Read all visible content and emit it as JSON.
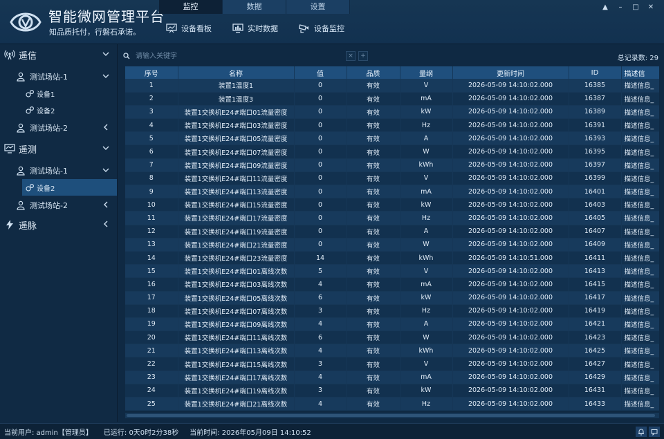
{
  "app": {
    "title": "智能微网管理平台",
    "slogan": "知品质托付，行磐石承诺。"
  },
  "top_tabs": [
    {
      "label": "监控",
      "active": true
    },
    {
      "label": "数据",
      "active": false
    },
    {
      "label": "设置",
      "active": false
    }
  ],
  "toolbar": {
    "device_board": "设备看板",
    "realtime_data": "实时数据",
    "device_monitor": "设备监控"
  },
  "window_controls": [
    "▲",
    "–",
    "□",
    "✕"
  ],
  "sidebar": {
    "telecomm": {
      "label": "遥信",
      "station1": "测试场站-1",
      "device1": "设备1",
      "device2": "设备2",
      "station2": "测试场站-2"
    },
    "telemetry": {
      "label": "遥测",
      "station1": "测试场站-1",
      "device2": "设备2",
      "station2": "测试场站-2"
    },
    "telepulse": {
      "label": "遥脉"
    }
  },
  "search": {
    "placeholder": "请输入关键字",
    "record_count": "总记录数: 29"
  },
  "table": {
    "headers": [
      "序号",
      "名称",
      "值",
      "品质",
      "量纲",
      "更新时间",
      "ID",
      "描述信"
    ],
    "rows": [
      [
        "1",
        "装置1温度1",
        "0",
        "有效",
        "V",
        "2026-05-09 14:10:02.000",
        "16385",
        "描述信息_"
      ],
      [
        "2",
        "装置1温度3",
        "0",
        "有效",
        "mA",
        "2026-05-09 14:10:02.000",
        "16387",
        "描述信息_"
      ],
      [
        "3",
        "装置1交换机E24#端口01流量密度",
        "0",
        "有效",
        "kW",
        "2026-05-09 14:10:02.000",
        "16389",
        "描述信息_"
      ],
      [
        "4",
        "装置1交换机E24#端口03流量密度",
        "0",
        "有效",
        "Hz",
        "2026-05-09 14:10:02.000",
        "16391",
        "描述信息_"
      ],
      [
        "5",
        "装置1交换机E24#端口05流量密度",
        "0",
        "有效",
        "A",
        "2026-05-09 14:10:02.000",
        "16393",
        "描述信息_"
      ],
      [
        "6",
        "装置1交换机E24#端口07流量密度",
        "0",
        "有效",
        "W",
        "2026-05-09 14:10:02.000",
        "16395",
        "描述信息_"
      ],
      [
        "7",
        "装置1交换机E24#端口09流量密度",
        "0",
        "有效",
        "kWh",
        "2026-05-09 14:10:02.000",
        "16397",
        "描述信息_"
      ],
      [
        "8",
        "装置1交换机E24#端口11流量密度",
        "0",
        "有效",
        "V",
        "2026-05-09 14:10:02.000",
        "16399",
        "描述信息_"
      ],
      [
        "9",
        "装置1交换机E24#端口13流量密度",
        "0",
        "有效",
        "mA",
        "2026-05-09 14:10:02.000",
        "16401",
        "描述信息_"
      ],
      [
        "10",
        "装置1交换机E24#端口15流量密度",
        "0",
        "有效",
        "kW",
        "2026-05-09 14:10:02.000",
        "16403",
        "描述信息_"
      ],
      [
        "11",
        "装置1交换机E24#端口17流量密度",
        "0",
        "有效",
        "Hz",
        "2026-05-09 14:10:02.000",
        "16405",
        "描述信息_"
      ],
      [
        "12",
        "装置1交换机E24#端口19流量密度",
        "0",
        "有效",
        "A",
        "2026-05-09 14:10:02.000",
        "16407",
        "描述信息_"
      ],
      [
        "13",
        "装置1交换机E24#端口21流量密度",
        "0",
        "有效",
        "W",
        "2026-05-09 14:10:02.000",
        "16409",
        "描述信息_"
      ],
      [
        "14",
        "装置1交换机E24#端口23流量密度",
        "14",
        "有效",
        "kWh",
        "2026-05-09 14:10:51.000",
        "16411",
        "描述信息_"
      ],
      [
        "15",
        "装置1交换机E24#端口01离线次数",
        "5",
        "有效",
        "V",
        "2026-05-09 14:10:02.000",
        "16413",
        "描述信息_"
      ],
      [
        "16",
        "装置1交换机E24#端口03离线次数",
        "4",
        "有效",
        "mA",
        "2026-05-09 14:10:02.000",
        "16415",
        "描述信息_"
      ],
      [
        "17",
        "装置1交换机E24#端口05离线次数",
        "6",
        "有效",
        "kW",
        "2026-05-09 14:10:02.000",
        "16417",
        "描述信息_"
      ],
      [
        "18",
        "装置1交换机E24#端口07离线次数",
        "3",
        "有效",
        "Hz",
        "2026-05-09 14:10:02.000",
        "16419",
        "描述信息_"
      ],
      [
        "19",
        "装置1交换机E24#端口09离线次数",
        "4",
        "有效",
        "A",
        "2026-05-09 14:10:02.000",
        "16421",
        "描述信息_"
      ],
      [
        "20",
        "装置1交换机E24#端口11离线次数",
        "6",
        "有效",
        "W",
        "2026-05-09 14:10:02.000",
        "16423",
        "描述信息_"
      ],
      [
        "21",
        "装置1交换机E24#端口13离线次数",
        "4",
        "有效",
        "kWh",
        "2026-05-09 14:10:02.000",
        "16425",
        "描述信息_"
      ],
      [
        "22",
        "装置1交换机E24#端口15离线次数",
        "3",
        "有效",
        "V",
        "2026-05-09 14:10:02.000",
        "16427",
        "描述信息_"
      ],
      [
        "23",
        "装置1交换机E24#端口17离线次数",
        "4",
        "有效",
        "mA",
        "2026-05-09 14:10:02.000",
        "16429",
        "描述信息_"
      ],
      [
        "24",
        "装置1交换机E24#端口19离线次数",
        "3",
        "有效",
        "kW",
        "2026-05-09 14:10:02.000",
        "16431",
        "描述信息_"
      ],
      [
        "25",
        "装置1交换机E24#端口21离线次数",
        "4",
        "有效",
        "Hz",
        "2026-05-09 14:10:02.000",
        "16433",
        "描述信息_"
      ]
    ]
  },
  "status": {
    "user": "当前用户: admin【管理员】",
    "uptime": "已运行: 0天0时2分38秒",
    "time": "当前时间: 2026年05月09日 14:10:52"
  },
  "colors": {
    "background": "#102a44",
    "header_row": "#1f4f7d",
    "row_odd": "#173a5c",
    "row_even": "#12314f",
    "selected": "#1e4f7c"
  }
}
